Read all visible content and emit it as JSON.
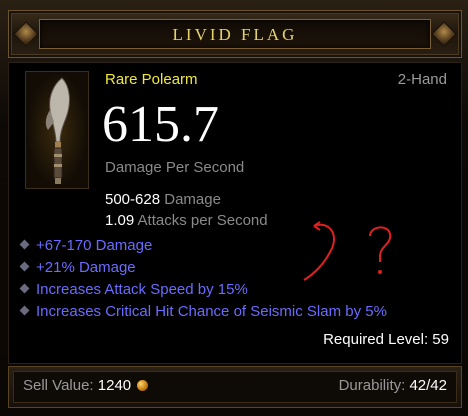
{
  "item": {
    "name": "LIVID FLAG",
    "rarity_type": "Rare Polearm",
    "slot": "2-Hand",
    "dps_value": "615.7",
    "dps_label": "Damage Per Second",
    "damage_range": "500-628",
    "damage_label": "Damage",
    "attacks_value": "1.09",
    "attacks_label": "Attacks per Second",
    "affixes": [
      "+67-170 Damage",
      "+21% Damage",
      "Increases Attack Speed by 15%",
      "Increases Critical Hit Chance of Seismic Slam by 5%"
    ],
    "required_level_text": "Required Level: 59",
    "sell_label": "Sell Value:",
    "sell_value": "1240",
    "durability_label": "Durability:",
    "durability_value": "42/42",
    "icon": "polearm-icon",
    "coin_icon": "gold-coin-icon"
  },
  "colors": {
    "title": "#e6d36c",
    "rare": "#f0e93c",
    "magic_affix": "#6b6bff",
    "annotation": "#e02020"
  },
  "annotation": {
    "mark": "?"
  }
}
